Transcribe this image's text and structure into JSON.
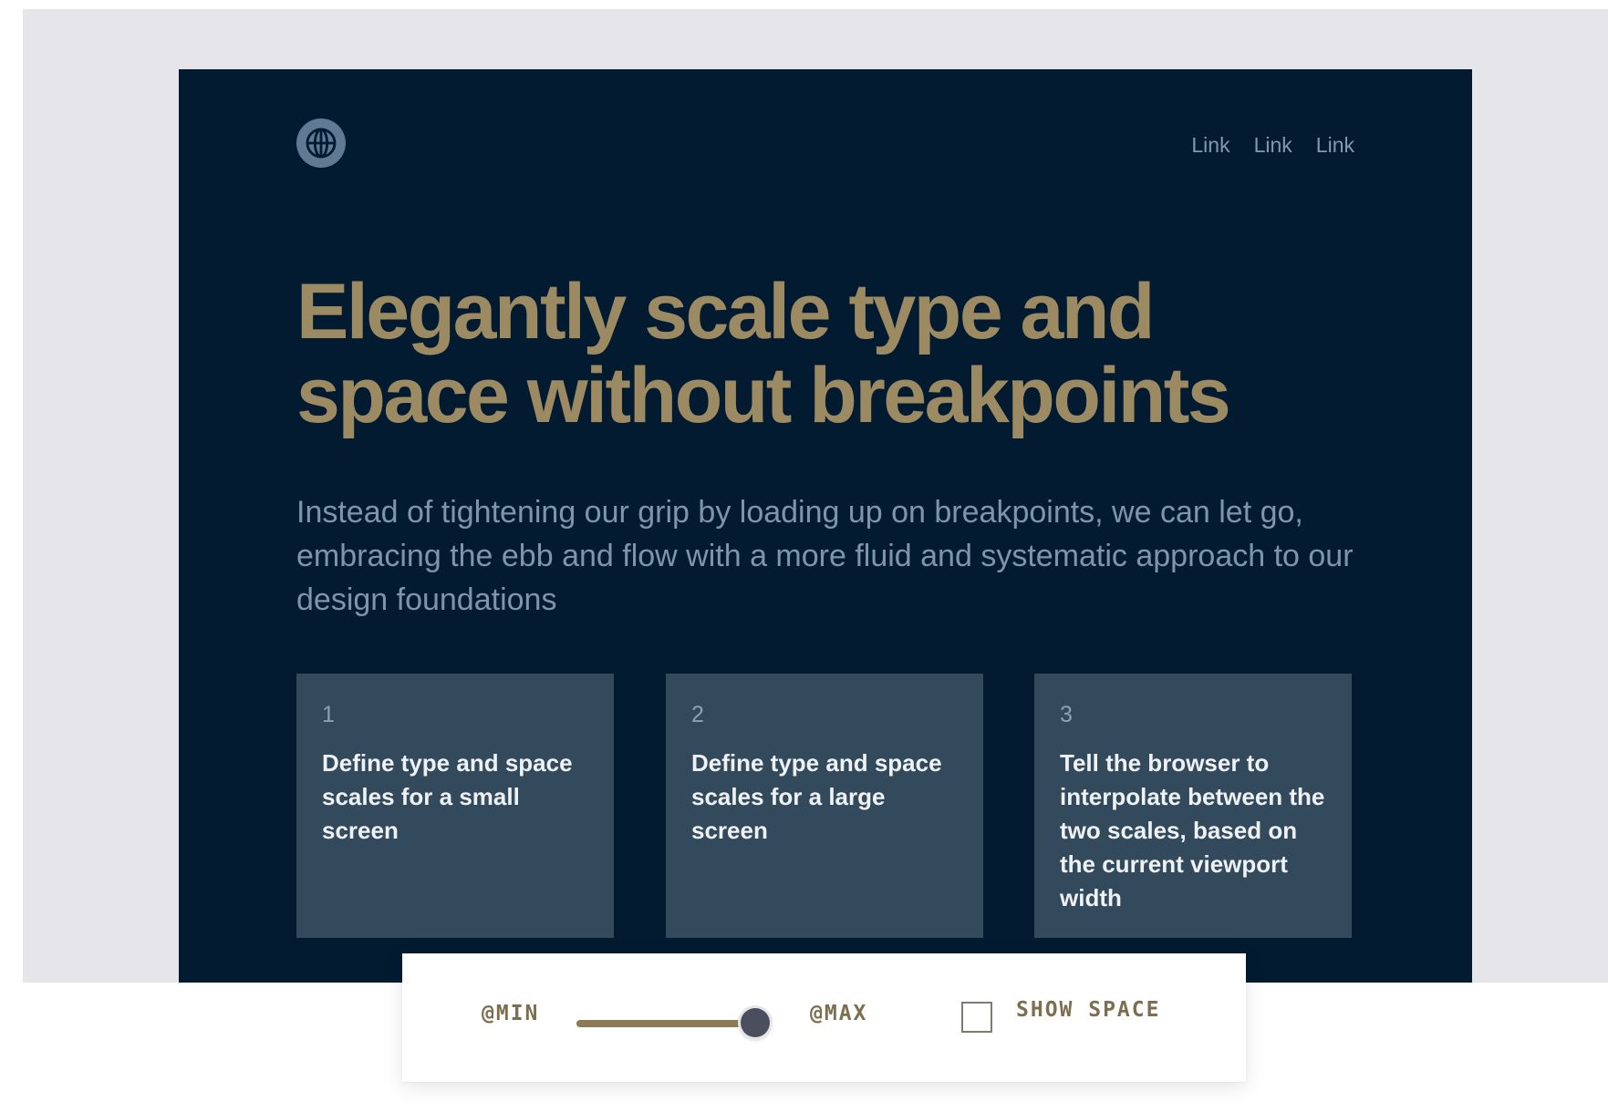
{
  "hero": {
    "nav_links": [
      "Link",
      "Link",
      "Link"
    ],
    "headline": "Elegantly scale type and space without breakpoints",
    "lead": "Instead of tightening our grip by loading up on breakpoints, we can let go, embracing the ebb and flow with a more fluid and systematic approach to our design foundations",
    "cards": [
      {
        "number": "1",
        "text": "Define type and space scales for a small screen"
      },
      {
        "number": "2",
        "text": "Define type and space scales for a large screen"
      },
      {
        "number": "3",
        "text": "Tell the browser to interpolate between the two scales, based on the current viewport width"
      }
    ]
  },
  "controls": {
    "min_label": "@MIN",
    "max_label": "@MAX",
    "slider_value": 1.0,
    "show_space_label": "SHOW SPACE",
    "show_space_checked": false
  },
  "colors": {
    "hero_background": "#031b31",
    "headline": "#9c8a62",
    "card_background": "#33495c",
    "accent": "#8d7b55"
  },
  "icons": {
    "logo": "globe-icon"
  }
}
